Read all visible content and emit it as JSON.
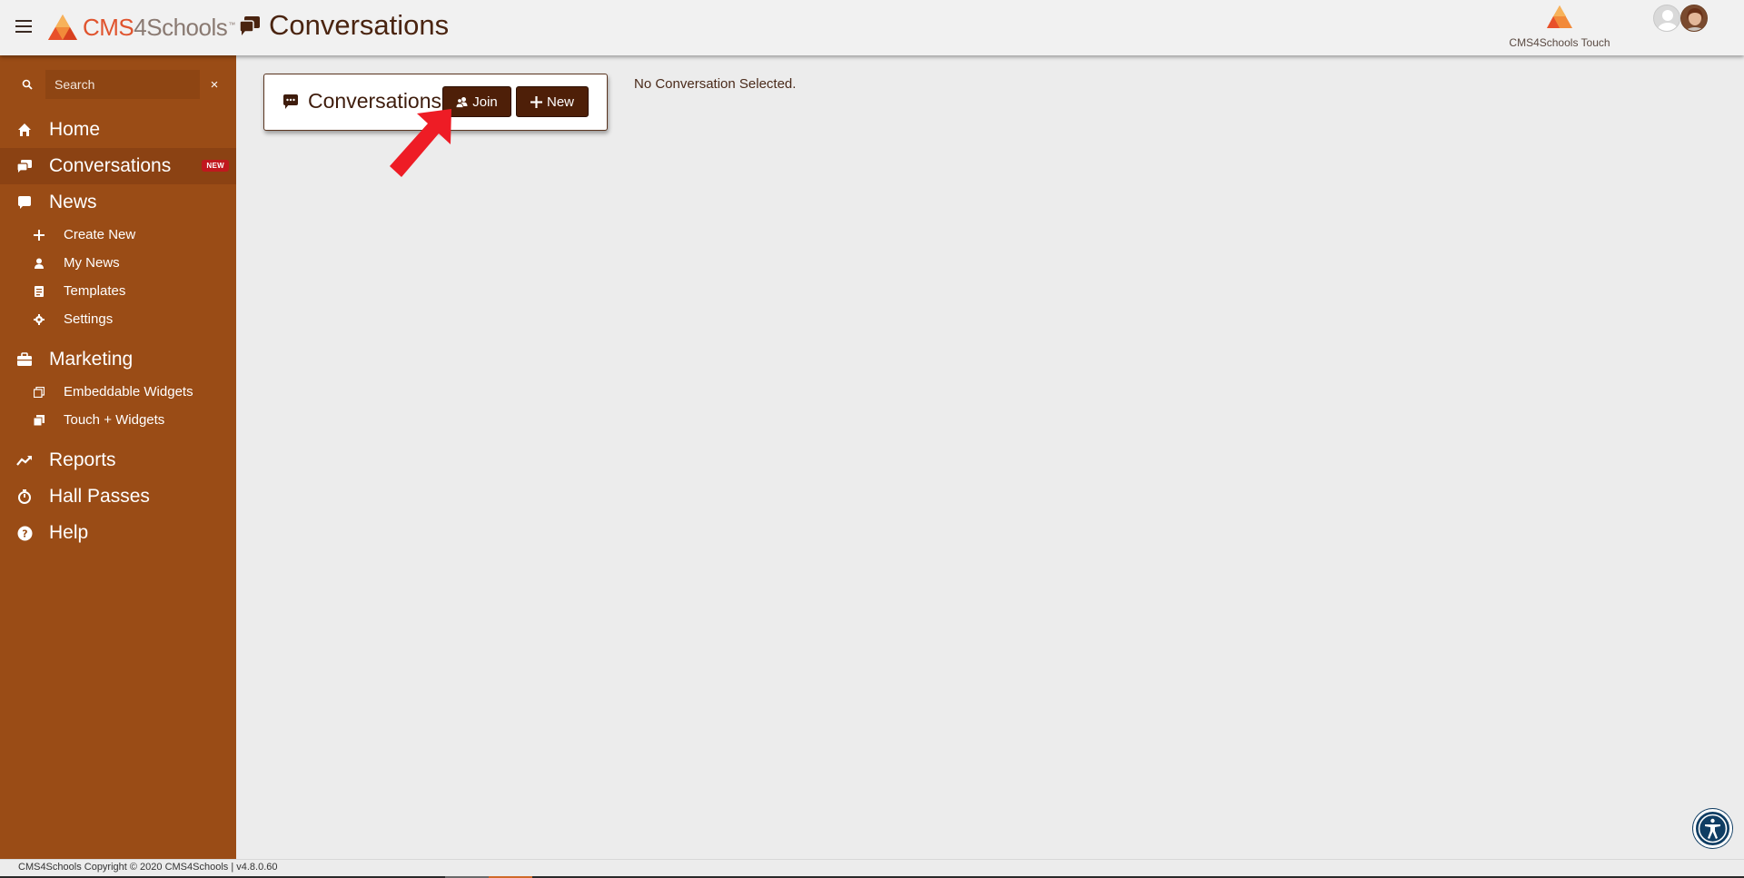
{
  "header": {
    "brand_cms": "CMS",
    "brand_4schools": "4Schools",
    "brand_tm": "™",
    "page_title": "Conversations",
    "touch_label": "CMS4Schools Touch"
  },
  "sidebar": {
    "search_placeholder": "Search",
    "search_clear": "×",
    "items": [
      {
        "label": "Home",
        "icon": "home-icon"
      },
      {
        "label": "Conversations",
        "icon": "conversations-icon",
        "badge": "NEW",
        "active": true
      },
      {
        "label": "News",
        "icon": "news-icon",
        "children": [
          {
            "label": "Create New",
            "icon": "plus-icon"
          },
          {
            "label": "My News",
            "icon": "user-icon"
          },
          {
            "label": "Templates",
            "icon": "templates-icon"
          },
          {
            "label": "Settings",
            "icon": "gear-icon"
          }
        ]
      },
      {
        "label": "Marketing",
        "icon": "briefcase-icon",
        "children": [
          {
            "label": "Embeddable Widgets",
            "icon": "widget-icon"
          },
          {
            "label": "Touch + Widgets",
            "icon": "stack-icon"
          }
        ]
      },
      {
        "label": "Reports",
        "icon": "trend-icon"
      },
      {
        "label": "Hall Passes",
        "icon": "stopwatch-icon"
      },
      {
        "label": "Help",
        "icon": "help-icon"
      }
    ]
  },
  "main": {
    "panel_title": "Conversations",
    "join_label": "Join",
    "new_label": "New",
    "empty_message": "No Conversation Selected."
  },
  "footer": {
    "text": "CMS4Schools Copyright © 2020 CMS4Schools | v4.8.0.60"
  },
  "colors": {
    "sidebar": "#9a4c16",
    "sidebar_active": "#8b4213",
    "button": "#4e1f08",
    "brand_orange": "#e0542e",
    "badge": "#c0181e",
    "annotation_arrow": "#ee1c25"
  }
}
